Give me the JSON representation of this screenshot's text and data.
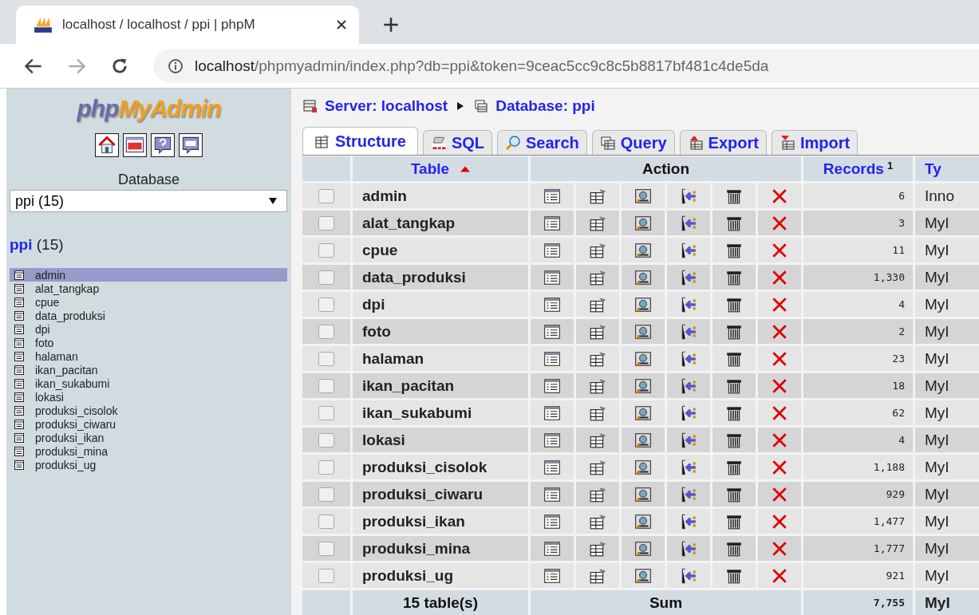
{
  "browser": {
    "tab_title": "localhost / localhost / ppi | phpM",
    "url_host": "localhost",
    "url_path": "/phpmyadmin/index.php?db=ppi&token=9ceac5cc9c8c5b8817bf481c4de5da"
  },
  "sidebar": {
    "logo_php": "php",
    "logo_myadmin": "MyAdmin",
    "database_label": "Database",
    "database_select": {
      "value": "ppi (15)"
    },
    "db_name": "ppi",
    "db_count": "(15)",
    "tables": [
      {
        "name": "admin",
        "selected": true
      },
      {
        "name": "alat_tangkap",
        "selected": false
      },
      {
        "name": "cpue",
        "selected": false
      },
      {
        "name": "data_produksi",
        "selected": false
      },
      {
        "name": "dpi",
        "selected": false
      },
      {
        "name": "foto",
        "selected": false
      },
      {
        "name": "halaman",
        "selected": false
      },
      {
        "name": "ikan_pacitan",
        "selected": false
      },
      {
        "name": "ikan_sukabumi",
        "selected": false
      },
      {
        "name": "lokasi",
        "selected": false
      },
      {
        "name": "produksi_cisolok",
        "selected": false
      },
      {
        "name": "produksi_ciwaru",
        "selected": false
      },
      {
        "name": "produksi_ikan",
        "selected": false
      },
      {
        "name": "produksi_mina",
        "selected": false
      },
      {
        "name": "produksi_ug",
        "selected": false
      }
    ]
  },
  "breadcrumb": {
    "server": "Server: localhost",
    "database": "Database: ppi"
  },
  "tabs": [
    {
      "label": "Structure",
      "kind": "structure",
      "selected": true
    },
    {
      "label": "SQL",
      "kind": "sql",
      "selected": false
    },
    {
      "label": "Search",
      "kind": "search",
      "selected": false
    },
    {
      "label": "Query",
      "kind": "query",
      "selected": false
    },
    {
      "label": "Export",
      "kind": "export",
      "selected": false
    },
    {
      "label": "Import",
      "kind": "import",
      "selected": false
    }
  ],
  "table": {
    "columns": {
      "table": "Table",
      "action": "Action",
      "records": "Records",
      "records_note": "1",
      "type": "Ty"
    },
    "rows": [
      {
        "checked": false,
        "name": "admin",
        "records": "6",
        "type": "Inno"
      },
      {
        "checked": false,
        "name": "alat_tangkap",
        "records": "3",
        "type": "MyI"
      },
      {
        "checked": false,
        "name": "cpue",
        "records": "11",
        "type": "MyI"
      },
      {
        "checked": false,
        "name": "data_produksi",
        "records": "1,330",
        "type": "MyI"
      },
      {
        "checked": false,
        "name": "dpi",
        "records": "4",
        "type": "MyI"
      },
      {
        "checked": false,
        "name": "foto",
        "records": "2",
        "type": "MyI"
      },
      {
        "checked": false,
        "name": "halaman",
        "records": "23",
        "type": "MyI"
      },
      {
        "checked": false,
        "name": "ikan_pacitan",
        "records": "18",
        "type": "MyI"
      },
      {
        "checked": false,
        "name": "ikan_sukabumi",
        "records": "62",
        "type": "MyI"
      },
      {
        "checked": false,
        "name": "lokasi",
        "records": "4",
        "type": "MyI"
      },
      {
        "checked": false,
        "name": "produksi_cisolok",
        "records": "1,188",
        "type": "MyI"
      },
      {
        "checked": false,
        "name": "produksi_ciwaru",
        "records": "929",
        "type": "MyI"
      },
      {
        "checked": false,
        "name": "produksi_ikan",
        "records": "1,477",
        "type": "MyI"
      },
      {
        "checked": false,
        "name": "produksi_mina",
        "records": "1,777",
        "type": "MyI"
      },
      {
        "checked": false,
        "name": "produksi_ug",
        "records": "921",
        "type": "MyI"
      }
    ],
    "footer": {
      "count": "15 table(s)",
      "sum_label": "Sum",
      "records": "7,755",
      "type": "MyI"
    }
  }
}
